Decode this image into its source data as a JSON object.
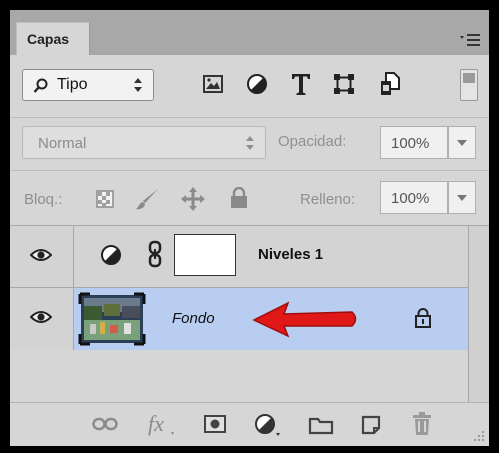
{
  "panel": {
    "tab_label": "Capas"
  },
  "filter": {
    "kind_label": "Tipo"
  },
  "blend": {
    "mode": "Normal",
    "opacity_label": "Opacidad:",
    "opacity_value": "100%"
  },
  "lock": {
    "label": "Bloq.:",
    "fill_label": "Relleno:",
    "fill_value": "100%"
  },
  "layers": [
    {
      "name": "Niveles 1",
      "type": "adjustment",
      "visible": true,
      "selected": false
    },
    {
      "name": "Fondo",
      "type": "background",
      "visible": true,
      "selected": true,
      "locked": true
    }
  ],
  "colors": {
    "selected_row": "#b8cdef",
    "arrow": "#e01818",
    "panel_bg": "#d6d6d6"
  }
}
